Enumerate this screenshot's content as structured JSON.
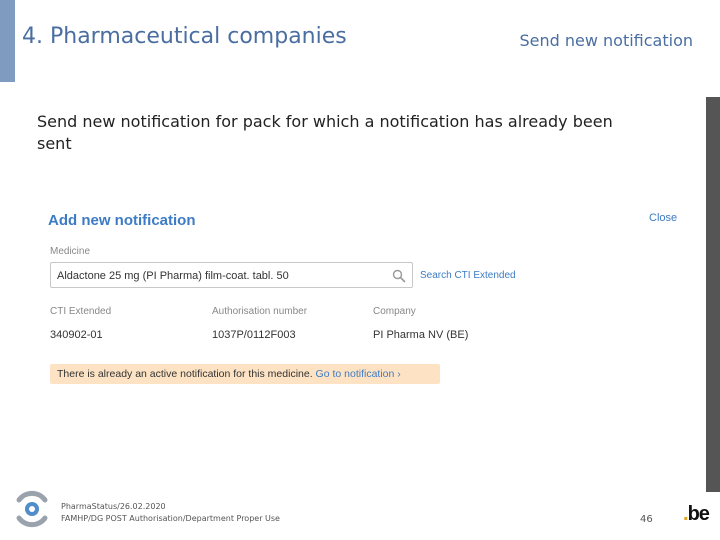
{
  "header": {
    "title": "4. Pharmaceutical companies",
    "subtitle": "Send new notification"
  },
  "intro_text": "Send new notification for pack for which a notification has already been sent",
  "panel": {
    "title": "Add new notification",
    "close_label": "Close",
    "medicine_label": "Medicine",
    "medicine_value": "Aldactone 25 mg (PI Pharma) film-coat. tabl. 50",
    "search_cti_label": "Search CTI Extended",
    "columns": [
      {
        "label": "CTI Extended",
        "value": "340902-01"
      },
      {
        "label": "Authorisation number",
        "value": "1037P/0112F003"
      },
      {
        "label": "Company",
        "value": "PI Pharma NV (BE)"
      }
    ],
    "notice_text": "There is already an active notification for this medicine.",
    "notice_link": "Go to notification ›"
  },
  "footer": {
    "line1": "PharmaStatus/26.02.2020",
    "line2": "FAMHP/DG POST Authorisation/Department Proper Use",
    "page_number": "46",
    "be_logo_dot": ".",
    "be_logo_text": "be"
  },
  "colors": {
    "accent": "#7f9cc0",
    "title": "#4a6ea0",
    "link": "#3d7bc4",
    "notice_bg": "#fde3c4",
    "side_bar": "#555555"
  }
}
